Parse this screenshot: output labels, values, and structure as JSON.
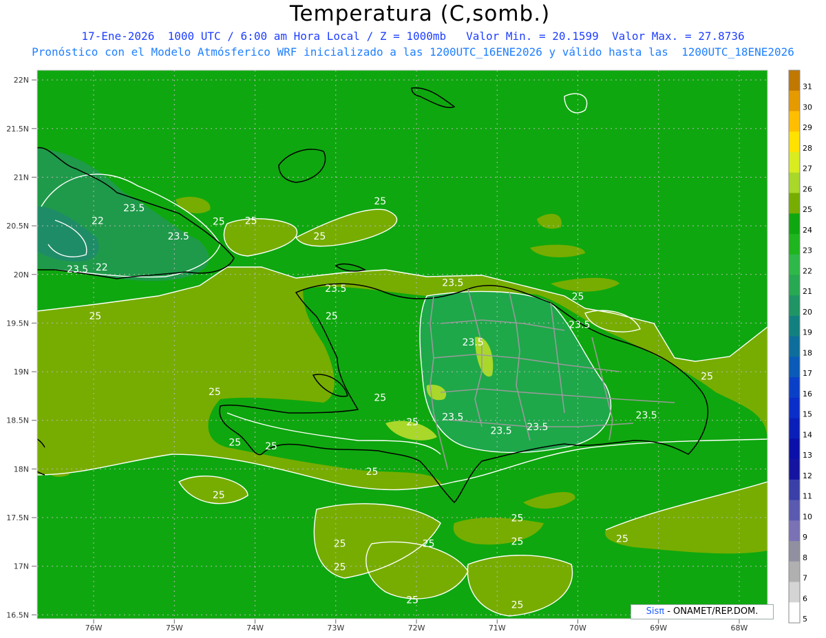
{
  "header": {
    "title": "Temperatura (C,somb.)",
    "line1": "17-Ene-2026  1000 UTC / 6:00 am Hora Local / Z = 1000mb   Valor Min. = 20.1599  Valor Max. = 27.8736",
    "line2": "Pronóstico con el Modelo Atmósferico WRF inicializado a las 1200UTC_16ENE2026 y válido hasta las  1200UTC_18ENE2026"
  },
  "axes": {
    "lat_labels": [
      "22N",
      "21.5N",
      "21N",
      "20.5N",
      "20N",
      "19.5N",
      "19N",
      "18.5N",
      "18N",
      "17.5N",
      "17N",
      "16.5N"
    ],
    "lon_labels": [
      "76W",
      "75W",
      "74W",
      "73W",
      "72W",
      "71W",
      "70W",
      "69W",
      "68W"
    ]
  },
  "colorbar": {
    "labels": [
      "31",
      "30",
      "29",
      "28",
      "27",
      "26",
      "25",
      "24",
      "23",
      "22",
      "21",
      "20",
      "19",
      "18",
      "17",
      "16",
      "15",
      "14",
      "13",
      "12",
      "11",
      "10",
      "9",
      "8",
      "7",
      "6",
      "5"
    ],
    "colors": [
      "#c07800",
      "#e59a00",
      "#ffbf00",
      "#ffe200",
      "#d8ec20",
      "#a9d82a",
      "#77ad00",
      "#0fa70f",
      "#1fb51f",
      "#2eb84a",
      "#27a852",
      "#1f9566",
      "#138080",
      "#0d6e9c",
      "#0a5ab8",
      "#0a40c8",
      "#0a2ec8",
      "#0a1fb8",
      "#0a10a8",
      "#1414a0",
      "#3a40a8",
      "#5a5ab0",
      "#7a72b5",
      "#9090a0",
      "#b0b0b0",
      "#d4d4d4",
      "#ffffff"
    ]
  },
  "contour_labels": [
    {
      "text": "23.5",
      "lat": 20.65,
      "lon": -75.5
    },
    {
      "text": "22",
      "lat": 20.52,
      "lon": -75.95
    },
    {
      "text": "23.5",
      "lat": 20.36,
      "lon": -74.95
    },
    {
      "text": "23.5",
      "lat": 20.02,
      "lon": -76.2
    },
    {
      "text": "22",
      "lat": 20.04,
      "lon": -75.9
    },
    {
      "text": "25",
      "lat": 20.51,
      "lon": -74.45
    },
    {
      "text": "25",
      "lat": 20.52,
      "lon": -74.05
    },
    {
      "text": "25",
      "lat": 20.72,
      "lon": -72.45
    },
    {
      "text": "25",
      "lat": 20.36,
      "lon": -73.2
    },
    {
      "text": "25",
      "lat": 19.54,
      "lon": -75.98
    },
    {
      "text": "23.5",
      "lat": 19.82,
      "lon": -73.0
    },
    {
      "text": "25",
      "lat": 19.54,
      "lon": -73.05
    },
    {
      "text": "23.5",
      "lat": 19.88,
      "lon": -71.55
    },
    {
      "text": "25",
      "lat": 19.74,
      "lon": -70.0
    },
    {
      "text": "23.5",
      "lat": 19.45,
      "lon": -69.98
    },
    {
      "text": "23.5",
      "lat": 19.27,
      "lon": -71.3
    },
    {
      "text": "25",
      "lat": 18.92,
      "lon": -68.4
    },
    {
      "text": "25",
      "lat": 18.76,
      "lon": -74.5
    },
    {
      "text": "25",
      "lat": 18.7,
      "lon": -72.45
    },
    {
      "text": "23.5",
      "lat": 18.5,
      "lon": -71.55
    },
    {
      "text": "25",
      "lat": 18.45,
      "lon": -72.05
    },
    {
      "text": "23.5",
      "lat": 18.36,
      "lon": -70.95
    },
    {
      "text": "23.5",
      "lat": 18.4,
      "lon": -70.5
    },
    {
      "text": "23.5",
      "lat": 18.52,
      "lon": -69.15
    },
    {
      "text": "25",
      "lat": 18.24,
      "lon": -74.25
    },
    {
      "text": "25",
      "lat": 18.2,
      "lon": -73.8
    },
    {
      "text": "25",
      "lat": 17.94,
      "lon": -72.55
    },
    {
      "text": "25",
      "lat": 17.7,
      "lon": -74.45
    },
    {
      "text": "25",
      "lat": 17.46,
      "lon": -70.75
    },
    {
      "text": "25",
      "lat": 17.25,
      "lon": -69.45
    },
    {
      "text": "25",
      "lat": 17.2,
      "lon": -72.95
    },
    {
      "text": "25",
      "lat": 17.2,
      "lon": -71.85
    },
    {
      "text": "25",
      "lat": 17.22,
      "lon": -70.75
    },
    {
      "text": "25",
      "lat": 16.96,
      "lon": -72.95
    },
    {
      "text": "25",
      "lat": 16.62,
      "lon": -72.05
    },
    {
      "text": "25",
      "lat": 16.57,
      "lon": -70.75
    }
  ],
  "colors": {
    "field_24": "#0fa70f",
    "field_25": "#77ad00",
    "field_23": "#1fb51f",
    "field_22": "#27a852",
    "field_21": "#1f9566",
    "field_26": "#a9d82a",
    "coast": "#000000",
    "border": "#9a9a9a",
    "contour": "#ffffff"
  },
  "credit": {
    "brand": "Sisπ",
    "text": " - ONAMET/REP.DOM."
  }
}
